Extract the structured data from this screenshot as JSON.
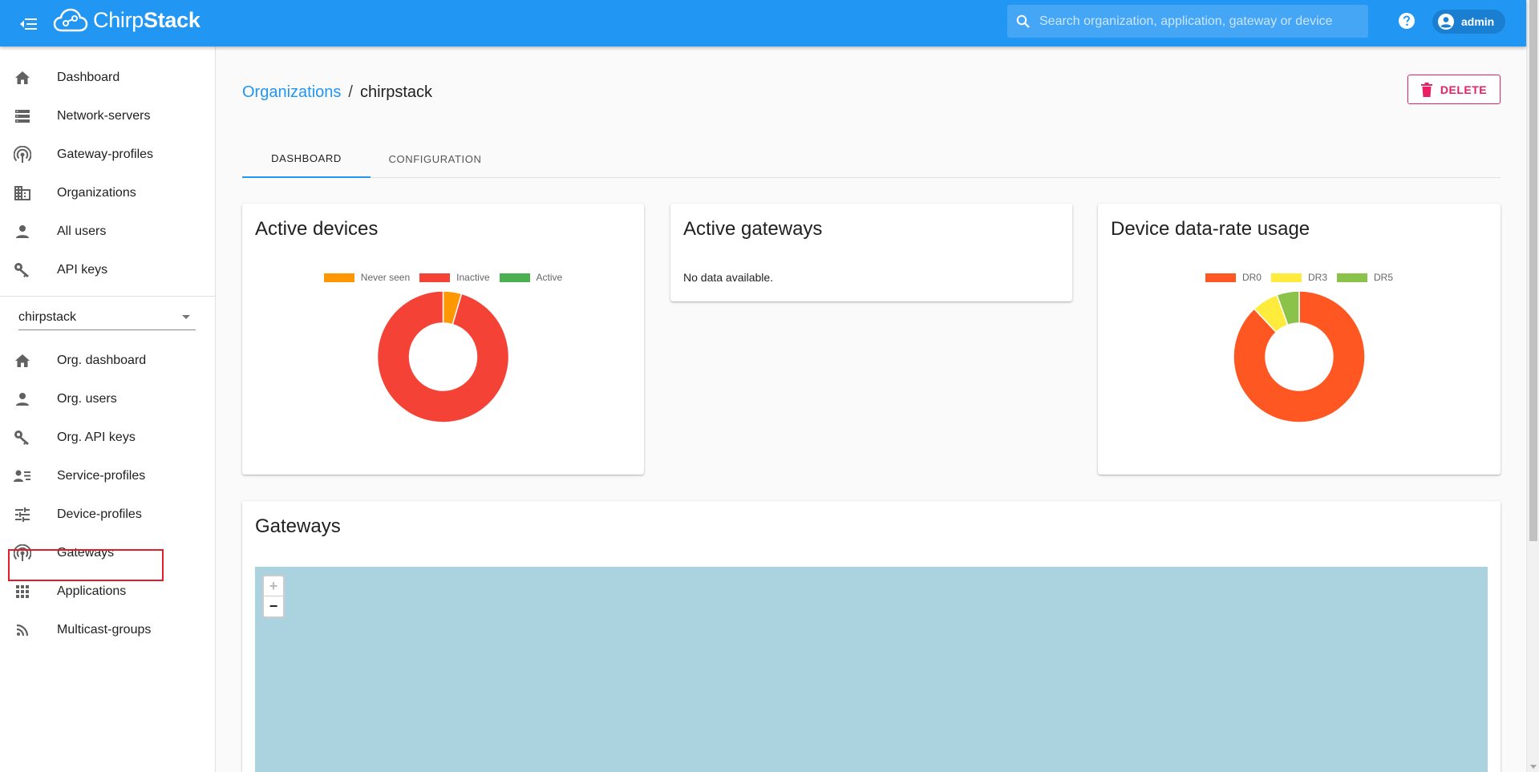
{
  "app": {
    "logo_light": "Chirp",
    "logo_bold": "Stack",
    "search_placeholder": "Search organization, application, gateway or device",
    "user_name": "admin"
  },
  "sidebar": {
    "global_items": [
      {
        "label": "Dashboard",
        "icon": "home-icon"
      },
      {
        "label": "Network-servers",
        "icon": "storage-icon"
      },
      {
        "label": "Gateway-profiles",
        "icon": "antenna-icon"
      },
      {
        "label": "Organizations",
        "icon": "domain-icon"
      },
      {
        "label": "All users",
        "icon": "person-icon"
      },
      {
        "label": "API keys",
        "icon": "key-icon"
      }
    ],
    "org_selector_value": "chirpstack",
    "org_items": [
      {
        "label": "Org. dashboard",
        "icon": "home-icon"
      },
      {
        "label": "Org. users",
        "icon": "person-icon"
      },
      {
        "label": "Org. API keys",
        "icon": "key-icon"
      },
      {
        "label": "Service-profiles",
        "icon": "account-details-icon"
      },
      {
        "label": "Device-profiles",
        "icon": "tune-icon"
      },
      {
        "label": "Gateways",
        "icon": "antenna-icon"
      },
      {
        "label": "Applications",
        "icon": "apps-icon"
      },
      {
        "label": "Multicast-groups",
        "icon": "rss-icon"
      }
    ]
  },
  "header": {
    "breadcrumb_link": "Organizations",
    "breadcrumb_sep": "/",
    "breadcrumb_current": "chirpstack",
    "delete_label": "DELETE"
  },
  "tabs": [
    {
      "label": "DASHBOARD",
      "active": true
    },
    {
      "label": "CONFIGURATION",
      "active": false
    }
  ],
  "cards": {
    "active_devices": {
      "title": "Active devices"
    },
    "active_gateways": {
      "title": "Active gateways",
      "no_data": "No data available."
    },
    "data_rate": {
      "title": "Device data-rate usage"
    },
    "gateways": {
      "title": "Gateways"
    }
  },
  "map": {
    "zoom_in": "+",
    "zoom_out": "−"
  },
  "chart_data": [
    {
      "type": "pie",
      "title": "Active devices",
      "categories": [
        "Never seen",
        "Inactive",
        "Active"
      ],
      "values": [
        1,
        21,
        0
      ],
      "colors": [
        "#ff9800",
        "#f44336",
        "#4caf50"
      ],
      "legend": "top"
    },
    {
      "type": "pie",
      "title": "Device data-rate usage",
      "categories": [
        "DR0",
        "DR3",
        "DR5"
      ],
      "values": [
        88,
        6.5,
        5.5
      ],
      "colors": [
        "#ff5722",
        "#ffeb3b",
        "#8bc34a"
      ],
      "legend": "top"
    }
  ],
  "colors": {
    "primary": "#2196f3",
    "danger": "#e91e63",
    "map_water": "#aad3df"
  }
}
